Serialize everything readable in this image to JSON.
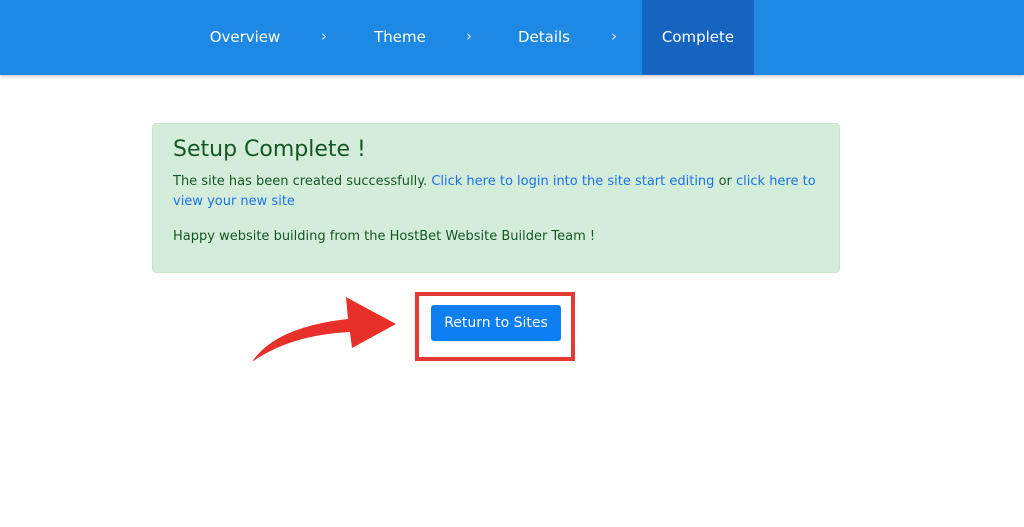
{
  "wizard": {
    "steps": [
      {
        "label": "Overview",
        "active": false
      },
      {
        "label": "Theme",
        "active": false
      },
      {
        "label": "Details",
        "active": false
      },
      {
        "label": "Complete",
        "active": true
      }
    ],
    "separator": "›"
  },
  "alert": {
    "title": "Setup Complete !",
    "text_prefix": "The site has been created successfully.",
    "login_link": "Click here to login into the site start editing",
    "text_or": "or",
    "view_link": "click here to view your new site",
    "closing": "Happy website building from the HostBet Website Builder Team !"
  },
  "actions": {
    "return_label": "Return to Sites"
  },
  "colors": {
    "header": "#1e88e5",
    "active_step": "#1565c0",
    "alert_bg": "#d4edda",
    "alert_text": "#155724",
    "link": "#1a73e8",
    "button": "#0d7ff2",
    "highlight": "#e53935"
  }
}
